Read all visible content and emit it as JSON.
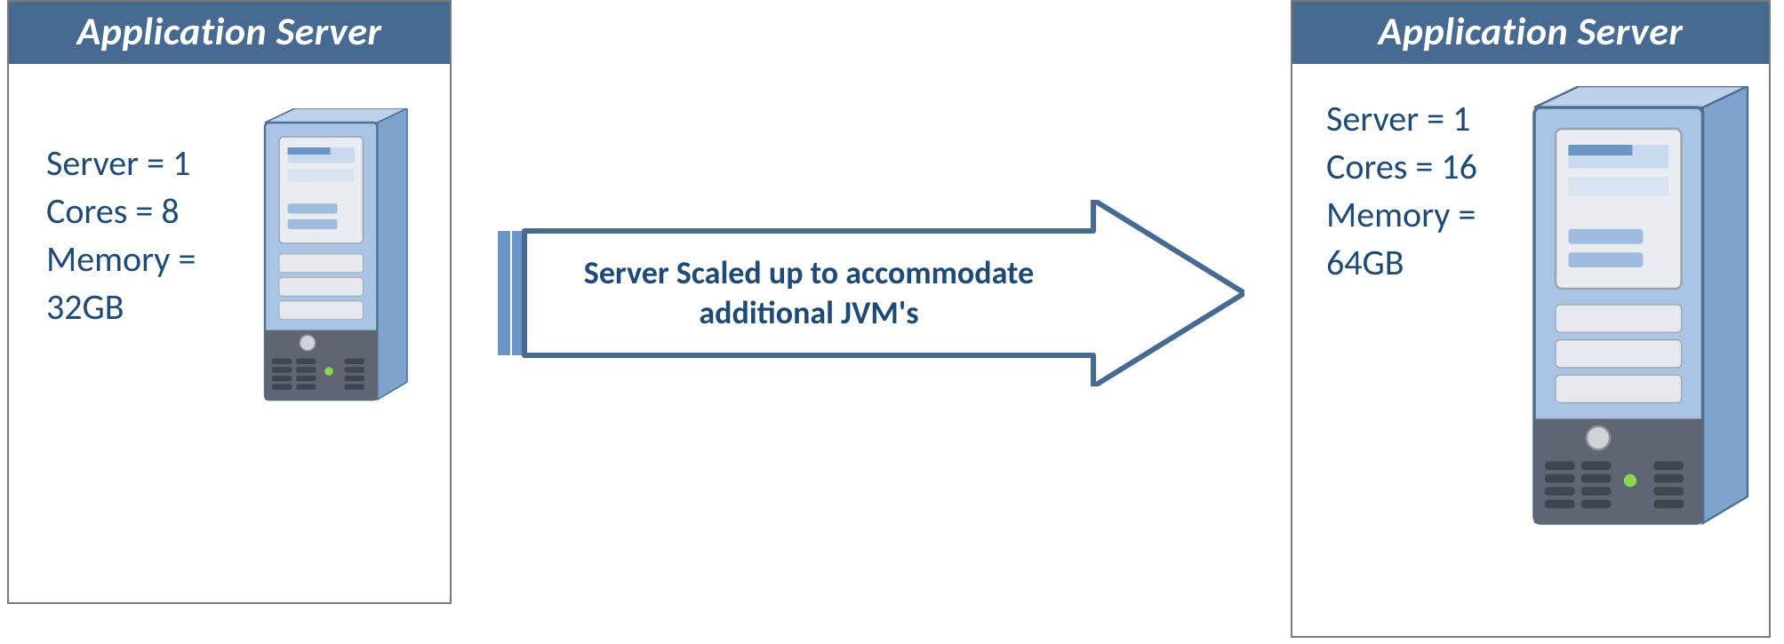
{
  "left": {
    "title": "Application Server",
    "server_line": "Server = 1",
    "cores_line": "Cores = 8",
    "memory_line": "Memory = 32GB"
  },
  "right": {
    "title": "Application Server",
    "server_line": "Server = 1",
    "cores_line": "Cores = 16",
    "memory_line": "Memory = 64GB"
  },
  "arrow": {
    "label": "Server Scaled up to accommodate additional JVM's"
  },
  "icons": {
    "server_tower": "server-tower-icon",
    "arrow_right": "right-arrow-icon"
  },
  "colors": {
    "header_bg": "#466a92",
    "text_blue": "#1e4a78",
    "tower_blue": "#9fbce0"
  }
}
